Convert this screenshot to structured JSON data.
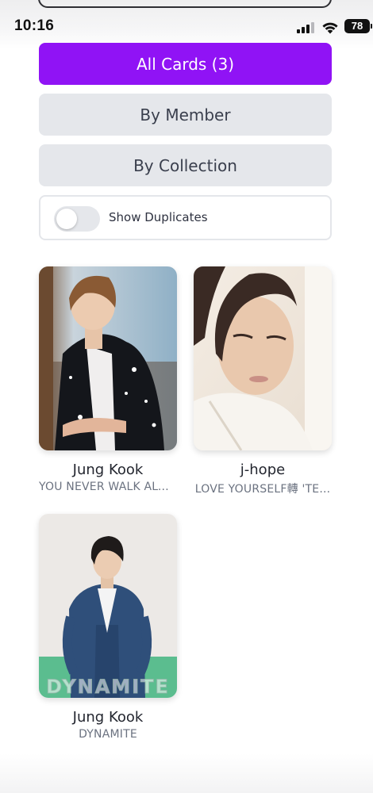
{
  "status_bar": {
    "time": "10:16",
    "battery": "78"
  },
  "filters": {
    "all_cards_label": "All Cards (3)",
    "by_member_label": "By Member",
    "by_collection_label": "By Collection",
    "show_duplicates_label": "Show Duplicates",
    "show_duplicates_on": false
  },
  "colors": {
    "accent": "#9013f5",
    "secondary_button": "#e5e7eb"
  },
  "cards": [
    {
      "member": "Jung Kook",
      "collection": "YOU NEVER WALK ALO..."
    },
    {
      "member": "j-hope",
      "collection": "LOVE YOURSELF轉 'TE..."
    },
    {
      "member": "Jung Kook",
      "collection": "DYNAMITE",
      "watermark": "DYNAMITE"
    }
  ]
}
